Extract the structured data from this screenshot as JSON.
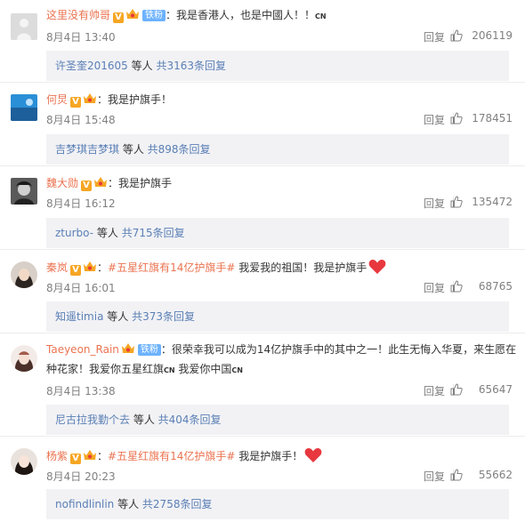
{
  "comments": [
    {
      "username": "这里没有帅哥",
      "fan_badge": "铁粉",
      "text": "：我是香港人，也是中國人！！",
      "cn": "CN",
      "time": "8月4日 13:40",
      "reply": "回复",
      "likes": "206119",
      "sub_user": "许圣奎201605",
      "sub_etc": " 等人 ",
      "sub_total": "共3163条回复"
    },
    {
      "username": "何炅",
      "text": "：我是护旗手！",
      "time": "8月4日 15:48",
      "reply": "回复",
      "likes": "178451",
      "sub_user": "吉梦琪吉梦琪",
      "sub_etc": " 等人 ",
      "sub_total": "共898条回复"
    },
    {
      "username": "魏大勋",
      "text": "：我是护旗手",
      "time": "8月4日 16:12",
      "reply": "回复",
      "likes": "135472",
      "sub_user": "zturbo-",
      "sub_etc": " 等人 ",
      "sub_total": "共715条回复"
    },
    {
      "username": "秦岚",
      "colon": "：",
      "topic": "#五星红旗有14亿护旗手#",
      "text": " 我爱我的祖国！我是护旗手",
      "time": "8月4日 16:01",
      "reply": "回复",
      "likes": "68765",
      "sub_user": "知遥timia",
      "sub_etc": " 等人 ",
      "sub_total": "共373条回复"
    },
    {
      "username": "Taeyeon_Rain",
      "fan_badge": "铁粉",
      "text_a": "：很荣幸我可以成为14亿护旗手中的其中之一！此生无悔入华夏，来生愿在种花家！我爱你五星红旗",
      "cn_a": "CN",
      "text_b": " 我爱你中国",
      "cn_b": "CN",
      "time": "8月4日 13:38",
      "reply": "回复",
      "likes": "65647",
      "sub_user": "尼古拉我勤个去",
      "sub_etc": " 等人 ",
      "sub_total": "共404条回复"
    },
    {
      "username": "杨紫",
      "colon": "：",
      "topic": "#五星红旗有14亿护旗手#",
      "text": " 我是护旗手！",
      "time": "8月4日 20:23",
      "reply": "回复",
      "likes": "55662",
      "sub_user": "nofindlinlin",
      "sub_etc": " 等人 ",
      "sub_total": "共2758条回复"
    }
  ],
  "colors": {
    "username": "#eb7350",
    "link": "#5a7fb5",
    "meta": "#808080",
    "subbox_bg": "#f2f2f5",
    "verified": "#f6a623"
  },
  "icons": [
    "verified-v-icon",
    "vip-crown-icon",
    "thumbs-up-icon",
    "heart-icon"
  ]
}
